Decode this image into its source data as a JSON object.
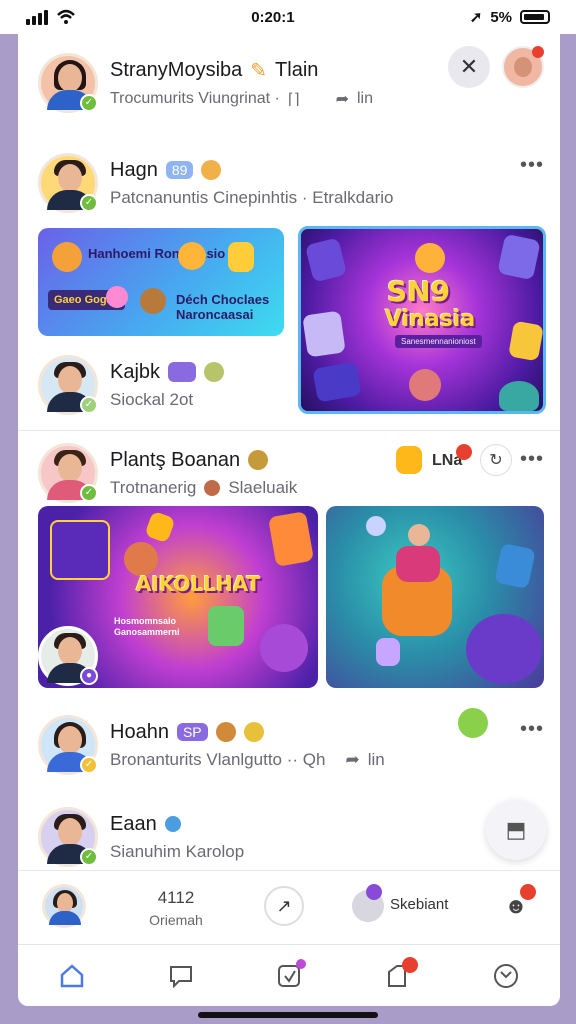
{
  "status_bar": {
    "time": "0:20:1",
    "battery": "5%"
  },
  "header": {
    "title": "StranyMoysiba",
    "title_suffix": "Tlain",
    "subtitle": "Trocumurits Viungrinat ·",
    "subtitle_suffix": "lin"
  },
  "feed": [
    {
      "name": "Hagn",
      "subtitle": "Patcnanuntis Cinepinhtis · Etralkdario"
    },
    {
      "name": "Kajbk",
      "subtitle": "Siockal 2ot"
    },
    {
      "name": "Plantş Boanan",
      "subtitle": "Trotnanerig",
      "subtitle_suffix": "Slaeluaik",
      "side_label": "LNa"
    },
    {
      "name": "Hoahn",
      "chip": "SP",
      "subtitle": "Bronanturits Vlanlgutto ·· Qh",
      "subtitle_suffix": "lin"
    },
    {
      "name": "Eaan",
      "subtitle": "Sianuhim Karolop"
    }
  ],
  "promo_card": {
    "top_text": "Hanhoemi Ronodiasio",
    "badge_text": "Gaeo Gogas",
    "bottom_text": "Déch Choclaes Naroncaasai"
  },
  "game_card": {
    "title_line1": "SN9",
    "title_line2": "Vinasia",
    "caption": "Sanesmennanioniost"
  },
  "festival_card": {
    "headline": "AIKOLLHAT",
    "caption": "Hosmomnsaio Ganosammerni"
  },
  "chip_hagn": "89",
  "bottom_bar": {
    "count": "4112",
    "count_label": "Oriemah",
    "user_label": "Skebiant"
  },
  "colors": {
    "accent": "#8a6ae0",
    "online": "#6fbd3c",
    "badge": "#e8402f"
  }
}
